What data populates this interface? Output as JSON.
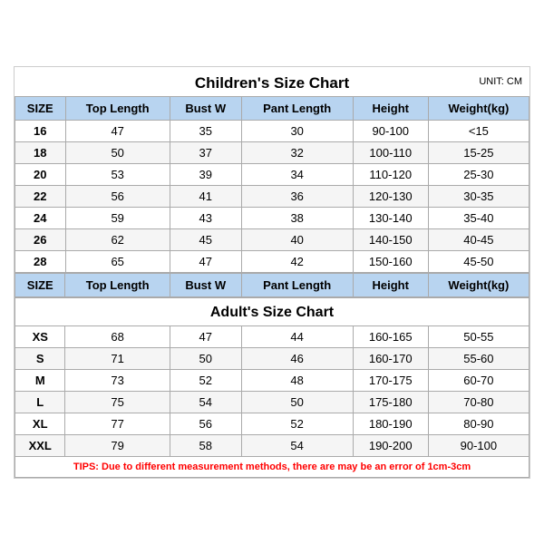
{
  "page": {
    "children_title": "Children's Size Chart",
    "adults_title": "Adult's Size Chart",
    "unit": "UNIT: CM",
    "tips": "TIPS: Due to different measurement methods, there are may be an error of 1cm-3cm",
    "headers": [
      "SIZE",
      "Top Length",
      "Bust W",
      "Pant Length",
      "Height",
      "Weight(kg)"
    ],
    "children_rows": [
      [
        "16",
        "47",
        "35",
        "30",
        "90-100",
        "<15"
      ],
      [
        "18",
        "50",
        "37",
        "32",
        "100-110",
        "15-25"
      ],
      [
        "20",
        "53",
        "39",
        "34",
        "110-120",
        "25-30"
      ],
      [
        "22",
        "56",
        "41",
        "36",
        "120-130",
        "30-35"
      ],
      [
        "24",
        "59",
        "43",
        "38",
        "130-140",
        "35-40"
      ],
      [
        "26",
        "62",
        "45",
        "40",
        "140-150",
        "40-45"
      ],
      [
        "28",
        "65",
        "47",
        "42",
        "150-160",
        "45-50"
      ]
    ],
    "adult_rows": [
      [
        "XS",
        "68",
        "47",
        "44",
        "160-165",
        "50-55"
      ],
      [
        "S",
        "71",
        "50",
        "46",
        "160-170",
        "55-60"
      ],
      [
        "M",
        "73",
        "52",
        "48",
        "170-175",
        "60-70"
      ],
      [
        "L",
        "75",
        "54",
        "50",
        "175-180",
        "70-80"
      ],
      [
        "XL",
        "77",
        "56",
        "52",
        "180-190",
        "80-90"
      ],
      [
        "XXL",
        "79",
        "58",
        "54",
        "190-200",
        "90-100"
      ]
    ]
  }
}
